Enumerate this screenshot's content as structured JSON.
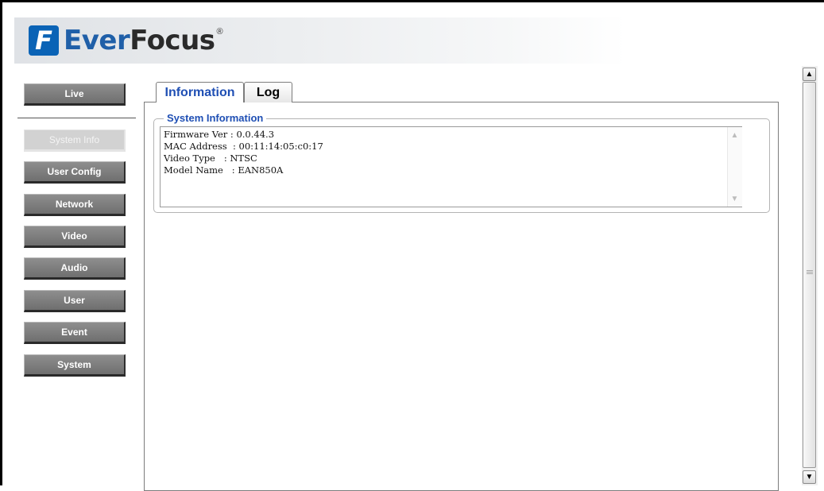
{
  "logo": {
    "brand_a": "Ever",
    "brand_b": "Focus",
    "mark": "F",
    "reg": "®"
  },
  "sidebar": {
    "live_label": "Live",
    "items": [
      {
        "label": "System Info",
        "active": true
      },
      {
        "label": "User Config"
      },
      {
        "label": "Network"
      },
      {
        "label": "Video"
      },
      {
        "label": "Audio"
      },
      {
        "label": "User"
      },
      {
        "label": "Event"
      },
      {
        "label": "System"
      }
    ]
  },
  "tabs": [
    {
      "label": "Information",
      "active": true
    },
    {
      "label": "Log"
    }
  ],
  "system_information": {
    "legend": "System Information",
    "lines": [
      "Firmware Ver : 0.0.44.3",
      "MAC Address  : 00:11:14:05:c0:17",
      "Video Type   : NTSC",
      "Model Name   : EAN850A"
    ]
  },
  "colors": {
    "accent": "#1f4fb4",
    "brand_blue": "#0a63b6",
    "button_gray": "#7a7a7a"
  }
}
